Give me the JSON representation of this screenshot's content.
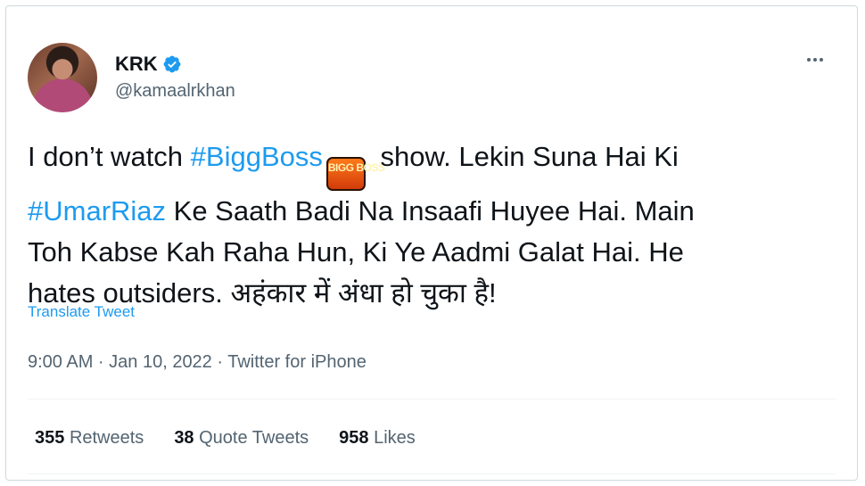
{
  "author": {
    "display_name": "KRK",
    "handle": "@kamaalrkhan",
    "verified": true,
    "verified_icon": "verified-badge-icon",
    "avatar_icon": "profile-photo"
  },
  "more_icon": "more-options-icon",
  "tweet": {
    "line1_pre": "I don’t watch ",
    "hashtag1": "#BiggBoss",
    "emoji_text": "BIGG BOSS",
    "line1_post": " show. Lekin Suna Hai Ki",
    "hashtag2": "#UmarRiaz",
    "line2_post": " Ke Saath Badi Na Insaafi Huyee Hai. Main",
    "line3": "Toh Kabse Kah Raha Hun, Ki Ye Aadmi Galat Hai. He",
    "line4": "hates outsiders. अहंकार में अंधा हो चुका है!"
  },
  "translate_label": "Translate Tweet",
  "meta": "9:00 AM · Jan 10, 2022 · Twitter for iPhone",
  "stats": [
    {
      "count": "355",
      "label": "Retweets"
    },
    {
      "count": "38",
      "label": "Quote Tweets"
    },
    {
      "count": "958",
      "label": "Likes"
    }
  ],
  "colors": {
    "accent": "#1d9bf0",
    "text": "#0f1419",
    "secondary": "#536471",
    "border": "#cfd9de"
  }
}
